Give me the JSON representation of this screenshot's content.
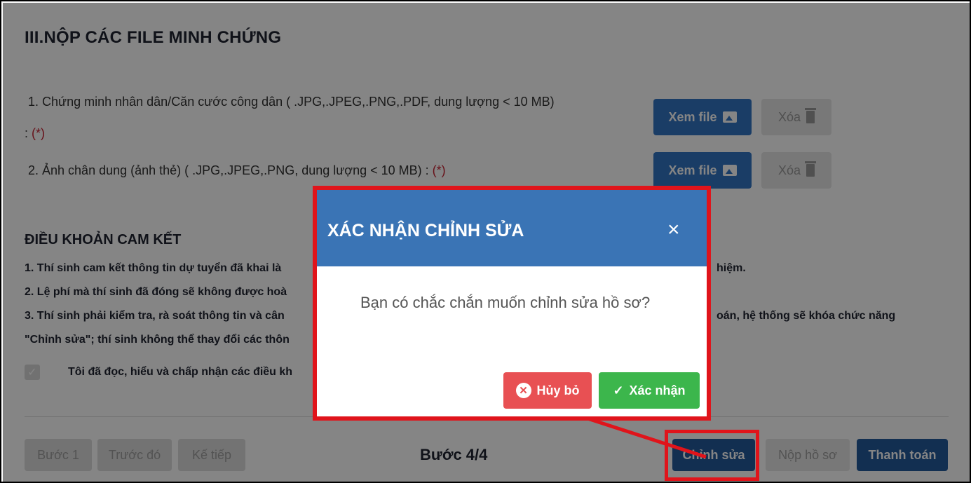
{
  "section": {
    "title": "III.NỘP CÁC FILE MINH CHỨNG"
  },
  "files": [
    {
      "label": "1. Chứng minh nhân dân/Căn cước công dân ( .JPG,.JPEG,.PNG,.PDF, dung lượng < 10 MB)",
      "suffix": ":",
      "required": "(*)",
      "view_label": "Xem file",
      "delete_label": "Xóa"
    },
    {
      "label": "2. Ảnh chân dung (ảnh thẻ) ( .JPG,.JPEG,.PNG, dung lượng < 10 MB) :",
      "required": "(*)",
      "view_label": "Xem file",
      "delete_label": "Xóa"
    }
  ],
  "terms": {
    "title": "ĐIỀU KHOẢN CAM KẾT",
    "line1_left": "1. Thí sinh cam kết thông tin dự tuyển đã khai là",
    "line1_right": "hiệm.",
    "line2_left": "2. Lệ phí mà thí sinh đã đóng sẽ không được hoà",
    "line3_left": "3. Thí sinh phải kiểm tra, rà soát thông tin và cân",
    "line3_right": "oán, hệ thống sẽ khóa chức năng",
    "line4_left": "\"Chỉnh sửa\"; thí sinh không thể thay đổi các thôn",
    "agree_text": "Tôi đã đọc, hiểu và chấp nhận các điều kh"
  },
  "footer": {
    "step1": "Bước 1",
    "prev": "Trước đó",
    "next": "Kế tiếp",
    "step_indicator": "Bước 4/4",
    "edit": "Chỉnh sửa",
    "submit": "Nộp hồ sơ",
    "pay": "Thanh toán"
  },
  "modal": {
    "title": "XÁC NHẬN CHỈNH SỬA",
    "close": "×",
    "message": "Bạn có chắc chắn muốn chỉnh sửa hồ sơ?",
    "cancel": "Hủy bỏ",
    "confirm": "Xác nhận"
  },
  "colors": {
    "primary": "#3276c4",
    "dark_primary": "#245a9c",
    "modal_header": "#3a74b5",
    "highlight": "#e0141b",
    "cancel": "#e85053",
    "confirm": "#3cb64c",
    "required": "#c82333"
  }
}
